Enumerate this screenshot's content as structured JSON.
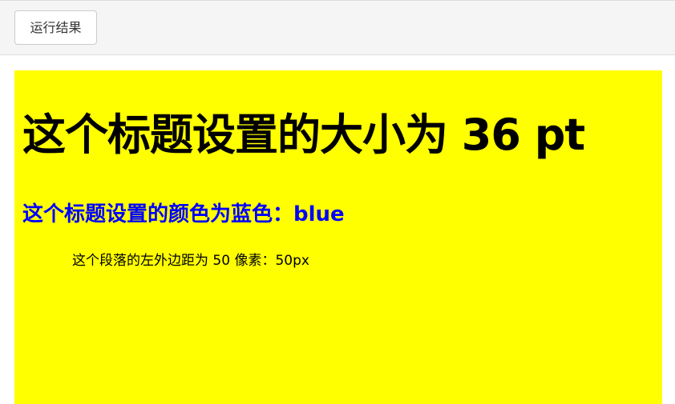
{
  "toolbar": {
    "run_button_label": "运行结果"
  },
  "result": {
    "background_color": "#ffff00",
    "heading_large": "这个标题设置的大小为 36 pt",
    "heading_blue": "这个标题设置的颜色为蓝色：blue",
    "heading_blue_color": "#0000ff",
    "paragraph": "这个段落的左外边距为 50 像素：50px"
  }
}
